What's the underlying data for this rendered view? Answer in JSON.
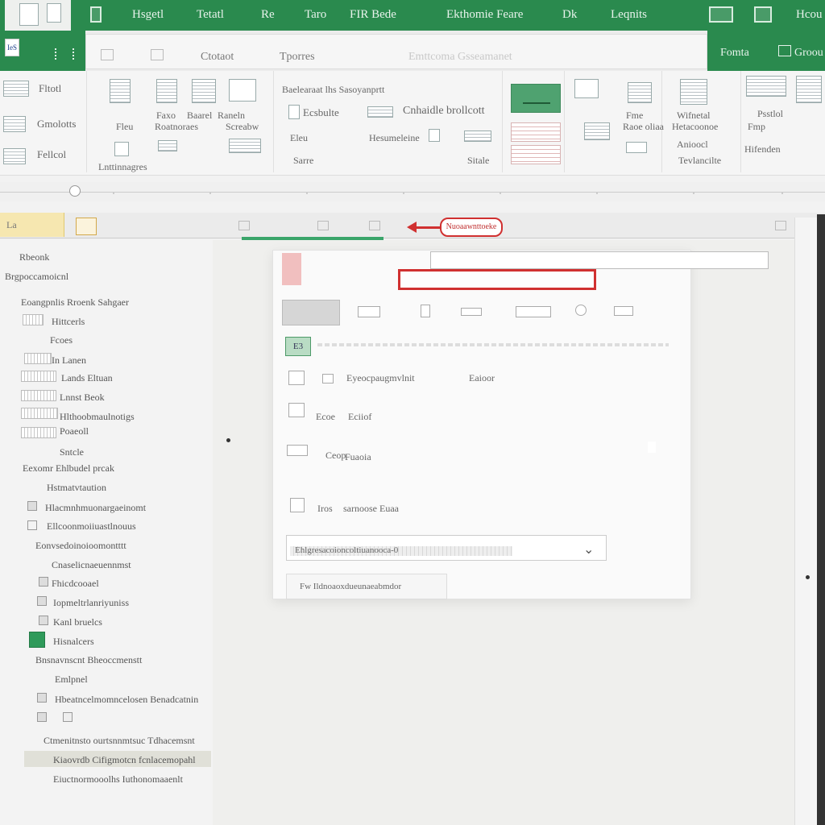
{
  "topbar": {
    "tabs": [
      "Hsgetl",
      "Tetatl",
      "Re",
      "Taro",
      "FIR Bede",
      "Ekthomie Feare",
      "Dk",
      "Leqnits",
      "Hcou"
    ]
  },
  "bar2": {
    "file_label": "IeS",
    "center_labels": [
      "Ctotaot",
      "Tporres",
      "Emttcoma Gsseamanet"
    ],
    "right_tabs": [
      "Fomta",
      "Groou"
    ]
  },
  "ribbon": {
    "left_labels": [
      "Fltotl",
      "Gmolotts",
      "Fellcol"
    ],
    "group1_labels": [
      "Faxo",
      "Baarel",
      "Raneln",
      "Fleu",
      "Roatnoraes",
      "Screabw",
      "Lnttinnagres"
    ],
    "group2_heading": "Baelearaat lhs Sasoyanprtt",
    "group2_labels": [
      "Ecsbulte",
      "Cnhaidle brollcott",
      "Eleu",
      "Hesumeleine",
      "Sarre",
      "Sitale"
    ],
    "group3_labels": [
      "Fme",
      "Raoe oliaa",
      "Wifnetal",
      "Hetacoonoe",
      "Anioocl",
      "Tevlancilte",
      "Psstlol",
      "Fmp",
      "Hifenden"
    ]
  },
  "formula_bar": {
    "name_box": "La",
    "callout": "Nuoaawnttoeke"
  },
  "leftpane": {
    "header1": "Rbeonk",
    "header2": "Brgpoccamoicnl",
    "section": "Eoangpnlis Rroenk Sahgaer",
    "items": [
      "Hittcerls",
      "Fcoes",
      "In Lanen",
      "Lands Eltuan",
      "Lnnst Beok",
      "Hlthoobmaulnotigs",
      "Poaeoll",
      "Sntcle",
      "Eexomr Ehlbudel prcak",
      "Hstmatvtaution",
      "Hlacmnhmuonargaeinomt",
      "Ellcoonmoiiuastlnouus",
      "Eonvsedoinoioomontttt",
      "Cnaselicnaeuennmst",
      "Fhicdcooael",
      "Iopmeltrlanriyuniss",
      "Kanl bruelcs",
      "Hisnalcers",
      "Bnsnavnscnt Bheoccmenstt",
      "Emlpnel",
      "Hbeatncelmomncelosen Benadcatnin",
      "Ctmenitnsto ourtsnnmtsuc Tdhacemsnt",
      "Kiaovrdb Cifigmotcn fcnlacemopahl",
      "Eiuctnormooolhs Iuthonomaaenlt"
    ]
  },
  "dialog": {
    "row1_labels": [
      "Eyeocpaugmvlnit",
      "Eaioor"
    ],
    "green_label": "E3",
    "row3_labels": [
      "Ecoe",
      "Eciiof"
    ],
    "row4_label": "Ceop",
    "row5_label": "Fuaoia",
    "row6_labels": [
      "Iros",
      "sarnoose Euaa"
    ],
    "field1_text": "Ehlgresacoioncoltiuanooca-0",
    "field2_text": "Fw Ildnoaoxdueunaeabmdor"
  }
}
